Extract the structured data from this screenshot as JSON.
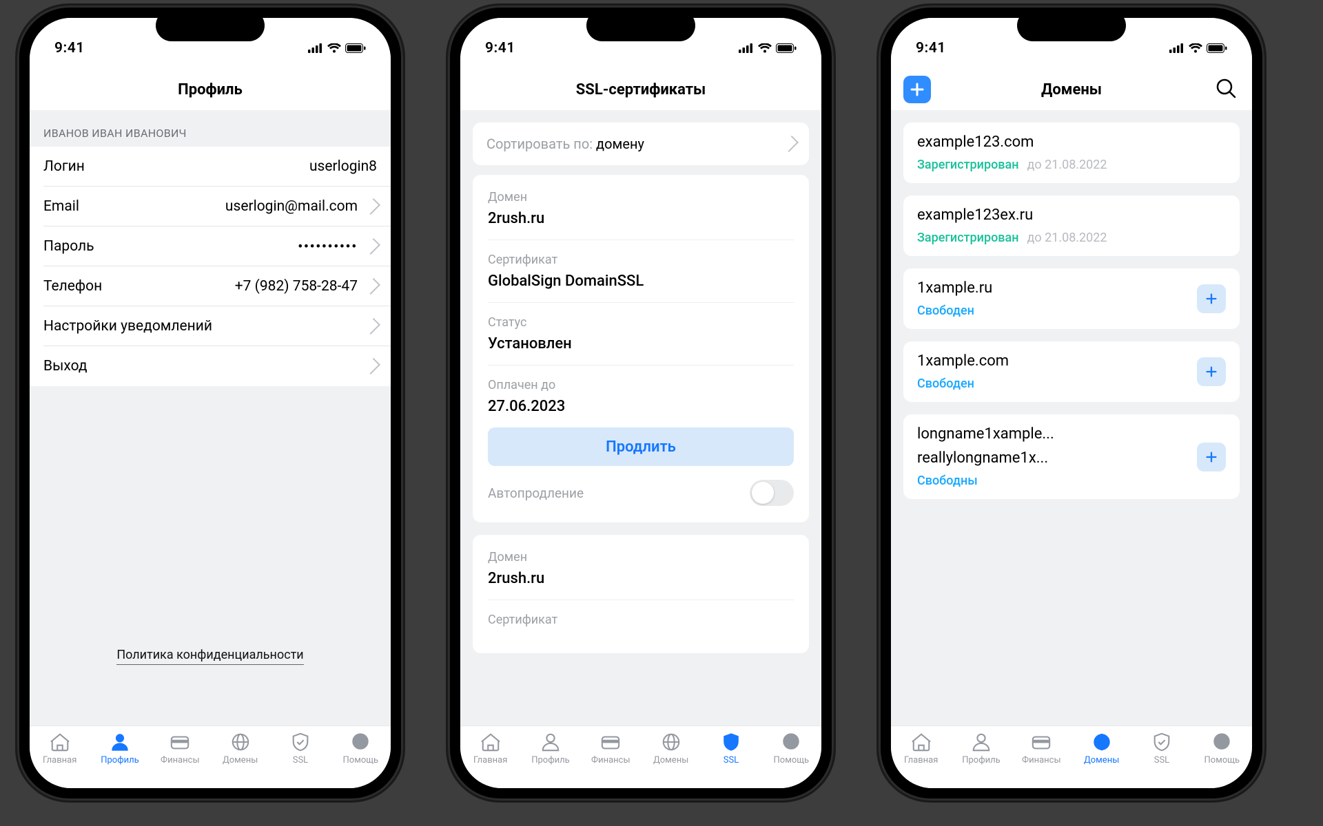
{
  "status": {
    "time": "9:41"
  },
  "tabs": {
    "home": "Главная",
    "profile": "Профиль",
    "finances": "Финансы",
    "domains": "Домены",
    "ssl": "SSL",
    "help": "Помощь"
  },
  "profile": {
    "title": "Профиль",
    "owner": "ИВАНОВ ИВАН ИВАНОВИЧ",
    "login_label": "Логин",
    "login_value": "userlogin8",
    "email_label": "Email",
    "email_value": "userlogin@mail.com",
    "password_label": "Пароль",
    "password_mask": "••••••••••",
    "phone_label": "Телефон",
    "phone_value": "+7 (982) 758-28-47",
    "notifications_label": "Настройки уведомлений",
    "logout_label": "Выход",
    "privacy_link": "Политика конфиденциальности"
  },
  "ssl": {
    "title": "SSL-сертификаты",
    "sort_label": "Сортировать по: ",
    "sort_value": "домену",
    "domain_label": "Домен",
    "domain_value": "2rush.ru",
    "cert_label": "Сертификат",
    "cert_value": "GlobalSign DomainSSL",
    "status_label": "Статус",
    "status_value": "Установлен",
    "paid_until_label": "Оплачен до",
    "paid_until_value": "27.06.2023",
    "renew_button": "Продлить",
    "autorenew_label": "Автопродление",
    "domain2_label": "Домен",
    "domain2_value": "2rush.ru",
    "cert2_label": "Сертификат"
  },
  "domains": {
    "title": "Домены",
    "items": [
      {
        "name": "example123.com",
        "status": "Зарегистрирован",
        "status_class": "green",
        "date": "до 21.08.2022",
        "add": false
      },
      {
        "name": "example123ex.ru",
        "status": "Зарегистрирован",
        "status_class": "green",
        "date": "до 21.08.2022",
        "add": false
      },
      {
        "name": "1xample.ru",
        "status": "Свободен",
        "status_class": "blue",
        "date": "",
        "add": true
      },
      {
        "name": "1xample.com",
        "status": "Свободен",
        "status_class": "blue",
        "date": "",
        "add": true
      },
      {
        "name": "longname1xample...",
        "name2": "reallylongname1x...",
        "status": "Свободны",
        "status_class": "blue",
        "date": "",
        "add": true
      }
    ]
  }
}
